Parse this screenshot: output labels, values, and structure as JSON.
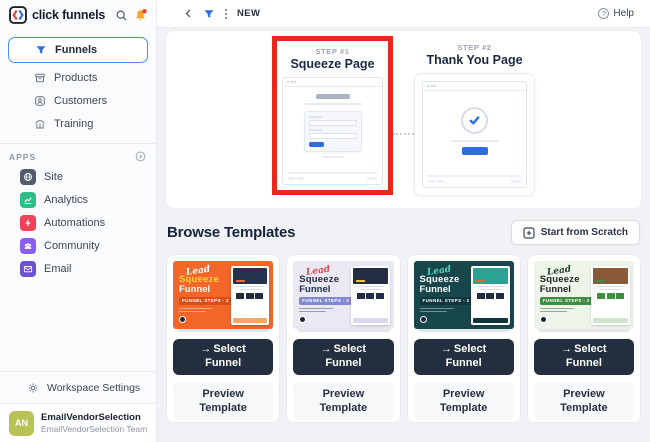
{
  "brand": {
    "name": "click funnels"
  },
  "topbar": {
    "funnel_name": "NEW",
    "help": "Help"
  },
  "sidebar": {
    "nav": [
      {
        "label": "Funnels",
        "selected": true
      },
      {
        "label": "Products",
        "selected": false
      },
      {
        "label": "Customers",
        "selected": false
      },
      {
        "label": "Training",
        "selected": false
      }
    ],
    "apps_heading": "APPS",
    "apps": [
      {
        "label": "Site",
        "color": "#525c6e"
      },
      {
        "label": "Analytics",
        "color": "#2dbd85"
      },
      {
        "label": "Automations",
        "color": "#f0435a"
      },
      {
        "label": "Community",
        "color": "#8b5cf6"
      },
      {
        "label": "Email",
        "color": "#6d4fd1"
      }
    ],
    "workspace_settings": "Workspace Settings",
    "profile": {
      "initials": "AN",
      "name": "EmailVendorSelection",
      "team": "EmailVendorSelection Team",
      "avatar_color": "#b9c254"
    }
  },
  "funnel_steps": {
    "highlight_color": "#e6281e",
    "accent_blue": "#2e6ce4",
    "steps": [
      {
        "step_label": "STEP #1",
        "title": "Squeeze Page",
        "highlighted": true
      },
      {
        "step_label": "STEP #2",
        "title": "Thank You Page",
        "highlighted": false
      }
    ]
  },
  "templates": {
    "heading": "Browse Templates",
    "start_from_scratch": "Start from Scratch",
    "select_label": "Select Funnel",
    "preview_label": "Preview Template",
    "cards": [
      {
        "script": "Lead",
        "line1": "Squeeze",
        "line2": "Funnel",
        "badge": "FUNNEL STEPS - 2",
        "theme": {
          "bg": "#f2662a",
          "script_color": "#ffffff",
          "line1_color": "#ffd43b",
          "line2_color": "#ffffff",
          "badge_bg": "#d94f16",
          "hero": "#24324e",
          "btn": "#f2662a",
          "squares": "#222c3e",
          "foot": "#f2a765"
        }
      },
      {
        "script": "Lead",
        "line1": "Squeeze",
        "line2": "Funnel",
        "badge": "FUNNEL STEPS - 2",
        "theme": {
          "bg": "#e9e8f3",
          "script_color": "#e2474e",
          "line1_color": "#232d44",
          "line2_color": "#232d44",
          "badge_bg": "#8287d2",
          "hero": "#232d44",
          "btn": "#f4c62c",
          "squares": "#232d44",
          "foot": "#d9d8ec"
        }
      },
      {
        "script": "Lead",
        "line1": "Squeeze",
        "line2": "Funnel",
        "badge": "FUNNEL STEPS - 2",
        "theme": {
          "bg": "#17474d",
          "script_color": "#56d7c3",
          "line1_color": "#ffffff",
          "line2_color": "#ffffff",
          "badge_bg": "#0e363c",
          "hero": "#2ba393",
          "btn": "#e8622c",
          "squares": "#222c3e",
          "foot": "#0e363c"
        }
      },
      {
        "script": "Lead",
        "line1": "Squeeze",
        "line2": "Funnel",
        "badge": "FUNNEL STEPS - 2",
        "theme": {
          "bg": "#edf4ea",
          "script_color": "#1e3b2c",
          "line1_color": "#1c2520",
          "line2_color": "#1c2520",
          "badge_bg": "#3e8d41",
          "hero": "#8a5a38",
          "btn": "#3e8d41",
          "squares": "#3e8d41",
          "foot": "#cfe4cc"
        }
      }
    ]
  }
}
